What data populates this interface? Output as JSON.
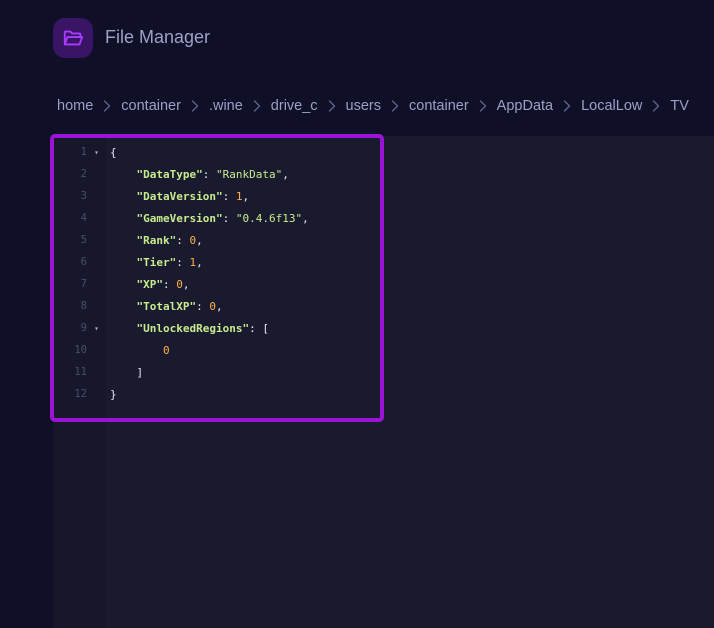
{
  "header": {
    "title": "File Manager",
    "icon": "folder-open-icon",
    "icon_color": "#a93bff"
  },
  "breadcrumb": {
    "items": [
      "home",
      "container",
      ".wine",
      "drive_c",
      "users",
      "container",
      "AppData",
      "LocalLow",
      "TV"
    ],
    "separator_icon": "chevron-right-icon"
  },
  "editor": {
    "fold_icon": "fold-triangle-icon",
    "lines": [
      {
        "num": "1",
        "fold": true,
        "indent": "",
        "tokens": [
          {
            "t": "p",
            "v": "{"
          }
        ]
      },
      {
        "num": "2",
        "fold": false,
        "indent": "    ",
        "tokens": [
          {
            "t": "k",
            "v": "\"DataType\""
          },
          {
            "t": "p",
            "v": ": "
          },
          {
            "t": "s",
            "v": "\"RankData\""
          },
          {
            "t": "p",
            "v": ","
          }
        ]
      },
      {
        "num": "3",
        "fold": false,
        "indent": "    ",
        "tokens": [
          {
            "t": "k",
            "v": "\"DataVersion\""
          },
          {
            "t": "p",
            "v": ": "
          },
          {
            "t": "n",
            "v": "1"
          },
          {
            "t": "p",
            "v": ","
          }
        ]
      },
      {
        "num": "4",
        "fold": false,
        "indent": "    ",
        "tokens": [
          {
            "t": "k",
            "v": "\"GameVersion\""
          },
          {
            "t": "p",
            "v": ": "
          },
          {
            "t": "s",
            "v": "\"0.4.6f13\""
          },
          {
            "t": "p",
            "v": ","
          }
        ]
      },
      {
        "num": "5",
        "fold": false,
        "indent": "    ",
        "tokens": [
          {
            "t": "k",
            "v": "\"Rank\""
          },
          {
            "t": "p",
            "v": ": "
          },
          {
            "t": "n",
            "v": "0"
          },
          {
            "t": "p",
            "v": ","
          }
        ]
      },
      {
        "num": "6",
        "fold": false,
        "indent": "    ",
        "tokens": [
          {
            "t": "k",
            "v": "\"Tier\""
          },
          {
            "t": "p",
            "v": ": "
          },
          {
            "t": "n",
            "v": "1"
          },
          {
            "t": "p",
            "v": ","
          }
        ]
      },
      {
        "num": "7",
        "fold": false,
        "indent": "    ",
        "tokens": [
          {
            "t": "k",
            "v": "\"XP\""
          },
          {
            "t": "p",
            "v": ": "
          },
          {
            "t": "n",
            "v": "0"
          },
          {
            "t": "p",
            "v": ","
          }
        ]
      },
      {
        "num": "8",
        "fold": false,
        "indent": "    ",
        "tokens": [
          {
            "t": "k",
            "v": "\"TotalXP\""
          },
          {
            "t": "p",
            "v": ": "
          },
          {
            "t": "n",
            "v": "0"
          },
          {
            "t": "p",
            "v": ","
          }
        ]
      },
      {
        "num": "9",
        "fold": true,
        "indent": "    ",
        "tokens": [
          {
            "t": "k",
            "v": "\"UnlockedRegions\""
          },
          {
            "t": "p",
            "v": ": ["
          }
        ]
      },
      {
        "num": "10",
        "fold": false,
        "indent": "        ",
        "tokens": [
          {
            "t": "n",
            "v": "0"
          }
        ]
      },
      {
        "num": "11",
        "fold": false,
        "indent": "    ",
        "tokens": [
          {
            "t": "p",
            "v": "]"
          }
        ]
      },
      {
        "num": "12",
        "fold": false,
        "indent": "",
        "tokens": [
          {
            "t": "p",
            "v": "}"
          }
        ]
      }
    ]
  },
  "colors": {
    "background": "#0f0f28",
    "editor_background": "#1a1a2e",
    "highlight_border": "#9b14d6",
    "json_key": "#c8eb8e",
    "json_number": "#ffb04a"
  }
}
